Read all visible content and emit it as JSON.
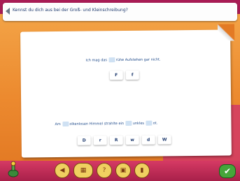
{
  "question": {
    "text": "Kennst du dich aus bei der Groß- und Kleinschreibung?"
  },
  "exercise1": {
    "before": "Ich mag das",
    "after": "rühe Aufstehen gar nicht.",
    "options": [
      "F",
      "f"
    ]
  },
  "exercise2": {
    "part1": "Am",
    "part2": "olkenlosen Himmel strahlte ein",
    "part3": "unkles",
    "part4": "ot.",
    "options": [
      "D",
      "r",
      "R",
      "w",
      "d",
      "W"
    ]
  },
  "toolbar": {
    "icons": [
      "back-icon",
      "score-icon",
      "help-icon",
      "chest-icon",
      "progress-icon"
    ]
  }
}
